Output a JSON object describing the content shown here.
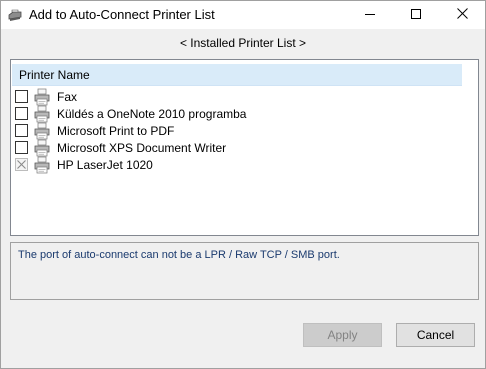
{
  "window": {
    "title": "Add to Auto-Connect Printer List"
  },
  "nav": {
    "link_label": "< Installed Printer List >"
  },
  "list": {
    "column_header": "Printer Name",
    "printers": [
      {
        "name": "Fax",
        "checked": false,
        "disabled": false
      },
      {
        "name": "Küldés a OneNote 2010 programba",
        "checked": false,
        "disabled": false
      },
      {
        "name": "Microsoft Print to PDF",
        "checked": false,
        "disabled": false
      },
      {
        "name": "Microsoft XPS Document Writer",
        "checked": false,
        "disabled": false
      },
      {
        "name": "HP LaserJet 1020",
        "checked": true,
        "disabled": true
      }
    ]
  },
  "info": {
    "message": "The port of auto-connect can not be a LPR / Raw TCP / SMB port."
  },
  "buttons": {
    "apply_label": "Apply",
    "cancel_label": "Cancel"
  },
  "icons": {
    "title": "printer-icon",
    "row": "printer-icon",
    "minimize": "minimize-icon",
    "maximize": "maximize-icon",
    "close": "close-icon"
  }
}
